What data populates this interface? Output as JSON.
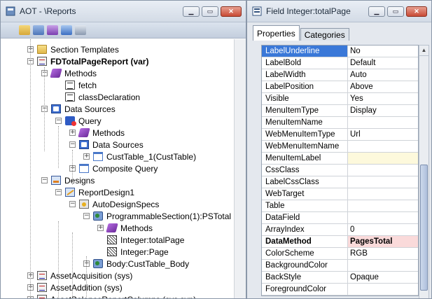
{
  "aot": {
    "title": "AOT - \\Reports",
    "tree": [
      {
        "label": "Section Templates",
        "icon": "folder-icon",
        "expander": "+",
        "bold": false
      },
      {
        "label": "FDTotalPageReport (var)",
        "icon": "report-icon",
        "expander": "−",
        "bold": true
      },
      {
        "label": "Methods",
        "icon": "methods-icon",
        "expander": "−",
        "bold": false
      },
      {
        "label": "fetch",
        "icon": "code-icon",
        "expander": "",
        "bold": false
      },
      {
        "label": "classDeclaration",
        "icon": "code-icon",
        "expander": "",
        "bold": false
      },
      {
        "label": "Data Sources",
        "icon": "datasources-icon",
        "expander": "−",
        "bold": false
      },
      {
        "label": "Query",
        "icon": "query-icon",
        "expander": "−",
        "bold": false
      },
      {
        "label": "Methods",
        "icon": "methods-icon",
        "expander": "+",
        "bold": false
      },
      {
        "label": "Data Sources",
        "icon": "datasources-icon",
        "expander": "−",
        "bold": false
      },
      {
        "label": "CustTable_1(CustTable)",
        "icon": "table-icon",
        "expander": "+",
        "bold": false
      },
      {
        "label": "Composite Query",
        "icon": "table-icon",
        "expander": "+",
        "bold": false
      },
      {
        "label": "Designs",
        "icon": "designs-icon",
        "expander": "−",
        "bold": false
      },
      {
        "label": "ReportDesign1",
        "icon": "design-icon",
        "expander": "−",
        "bold": false
      },
      {
        "label": "AutoDesignSpecs",
        "icon": "autodesign-icon",
        "expander": "−",
        "bold": false
      },
      {
        "label": "ProgrammableSection(1):PSTotal",
        "icon": "section-icon",
        "expander": "−",
        "bold": false
      },
      {
        "label": "Methods",
        "icon": "methods-icon",
        "expander": "+",
        "bold": false
      },
      {
        "label": "Integer:totalPage",
        "icon": "field-icon",
        "expander": "",
        "bold": false
      },
      {
        "label": "Integer:Page",
        "icon": "field-icon",
        "expander": "",
        "bold": false
      },
      {
        "label": "Body:CustTable_Body",
        "icon": "section-icon",
        "expander": "+",
        "bold": false
      },
      {
        "label": "AssetAcquisition (sys)",
        "icon": "report-icon",
        "expander": "+",
        "bold": false
      },
      {
        "label": "AssetAddition (sys)",
        "icon": "report-icon",
        "expander": "+",
        "bold": false
      },
      {
        "label": "AssetBalanceReportColumns (sys,syp)",
        "icon": "report-icon",
        "expander": "+",
        "bold": false
      }
    ]
  },
  "props": {
    "title": "Field Integer:totalPage",
    "tabs": [
      "Properties",
      "Categories"
    ],
    "rows": [
      {
        "name": "LabelUnderline",
        "value": "No"
      },
      {
        "name": "LabelBold",
        "value": "Default"
      },
      {
        "name": "LabelWidth",
        "value": "Auto"
      },
      {
        "name": "LabelPosition",
        "value": "Above"
      },
      {
        "name": "Visible",
        "value": "Yes"
      },
      {
        "name": "MenuItemType",
        "value": "Display"
      },
      {
        "name": "MenuItemName",
        "value": ""
      },
      {
        "name": "WebMenuItemType",
        "value": "Url"
      },
      {
        "name": "WebMenuItemName",
        "value": ""
      },
      {
        "name": "MenuItemLabel",
        "value": ""
      },
      {
        "name": "CssClass",
        "value": ""
      },
      {
        "name": "LabelCssClass",
        "value": ""
      },
      {
        "name": "WebTarget",
        "value": ""
      },
      {
        "name": "Table",
        "value": ""
      },
      {
        "name": "DataField",
        "value": ""
      },
      {
        "name": "ArrayIndex",
        "value": "0"
      },
      {
        "name": "DataMethod",
        "value": "PagesTotal"
      },
      {
        "name": "ColorScheme",
        "value": "RGB"
      },
      {
        "name": "BackgroundColor",
        "value": ""
      },
      {
        "name": "BackStyle",
        "value": "Opaque"
      },
      {
        "name": "ForegroundColor",
        "value": ""
      }
    ]
  },
  "colors": {
    "selected_row": "#3a78d8",
    "menuitemlabel_bg": "#fdf9dc",
    "datamethod_bg": "#fadada",
    "foreground_swatch": "#000000"
  }
}
